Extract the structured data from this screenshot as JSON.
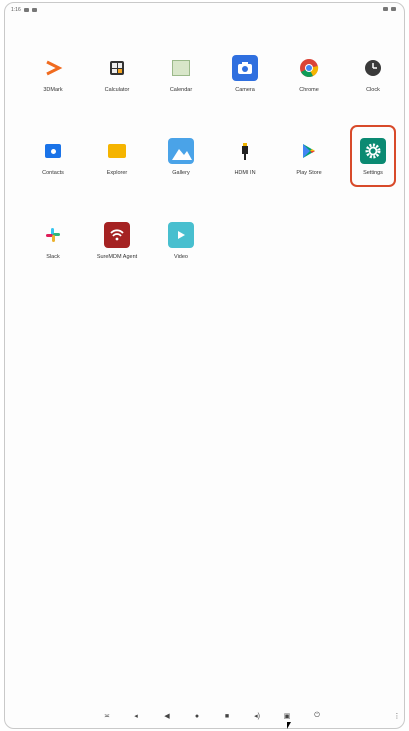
{
  "status_bar": {
    "time": "1:16",
    "right_icons": [
      "wifi-icon",
      "battery-icon"
    ]
  },
  "apps": [
    {
      "name": "3DMark",
      "label": "3DMark",
      "icon": "3dmark-icon",
      "bg": "#ffffff"
    },
    {
      "name": "Calculator",
      "label": "Calculator",
      "icon": "calculator-icon",
      "bg": "#ffffff"
    },
    {
      "name": "Calendar",
      "label": "Calendar",
      "icon": "calendar-icon",
      "bg": "#ffffff"
    },
    {
      "name": "Camera",
      "label": "Camera",
      "icon": "camera-icon",
      "bg": "#2f6fdf"
    },
    {
      "name": "Chrome",
      "label": "Chrome",
      "icon": "chrome-icon",
      "bg": "#ffffff"
    },
    {
      "name": "Clock",
      "label": "Clock",
      "icon": "clock-icon",
      "bg": "#ffffff"
    },
    {
      "name": "Contacts",
      "label": "Contacts",
      "icon": "contacts-icon",
      "bg": "#ffffff"
    },
    {
      "name": "Explorer",
      "label": "Explorer",
      "icon": "explorer-icon",
      "bg": "#ffffff"
    },
    {
      "name": "Gallery",
      "label": "Gallery",
      "icon": "gallery-icon",
      "bg": "#4aa3e8"
    },
    {
      "name": "HDMI IN",
      "label": "HDMI IN",
      "icon": "hdmi-icon",
      "bg": "#ffffff"
    },
    {
      "name": "Play Store",
      "label": "Play Store",
      "icon": "play-store-icon",
      "bg": "#ffffff"
    },
    {
      "name": "Settings",
      "label": "Settings",
      "icon": "gear-icon",
      "bg": "#0b8a72"
    },
    {
      "name": "Slack",
      "label": "Slack",
      "icon": "slack-icon",
      "bg": "#ffffff"
    },
    {
      "name": "SureMDM Agent",
      "label": "SureMDM Agent",
      "icon": "suremdm-icon",
      "bg": "#a52222"
    },
    {
      "name": "Video",
      "label": "Video",
      "icon": "video-icon",
      "bg": "#48bfcf"
    }
  ],
  "nav_bar": [
    "screenshot-icon",
    "volume-down-icon",
    "back-icon",
    "home-icon",
    "recents-icon",
    "volume-up-icon",
    "camera-icon",
    "power-icon",
    "menu-icon"
  ]
}
